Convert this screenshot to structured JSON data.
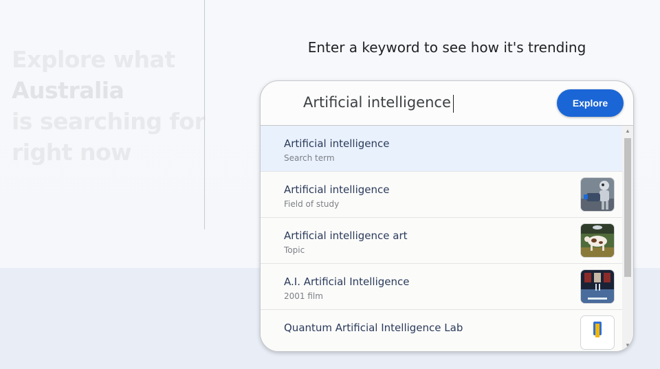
{
  "hero": {
    "line1": "Explore what",
    "line2": "Australia",
    "line3": "is searching for",
    "line4": "right now"
  },
  "prompt": "Enter a keyword to see how it's trending",
  "search": {
    "value": "Artificial intelligence",
    "explore_label": "Explore"
  },
  "suggestions": [
    {
      "title": "Artificial intelligence",
      "subtitle": "Search term",
      "thumbnail": "none",
      "selected": true
    },
    {
      "title": "Artificial intelligence",
      "subtitle": "Field of study",
      "thumbnail": "robot-image"
    },
    {
      "title": "Artificial intelligence art",
      "subtitle": "Topic",
      "thumbnail": "cow-image"
    },
    {
      "title": "A.I. Artificial Intelligence",
      "subtitle": "2001 film",
      "thumbnail": "film-poster-image"
    },
    {
      "title": "Quantum Artificial Intelligence Lab",
      "subtitle": "",
      "thumbnail": "lab-logo-image"
    }
  ],
  "colors": {
    "accent": "#1b66d6",
    "selected_row": "#e9f1fd"
  }
}
